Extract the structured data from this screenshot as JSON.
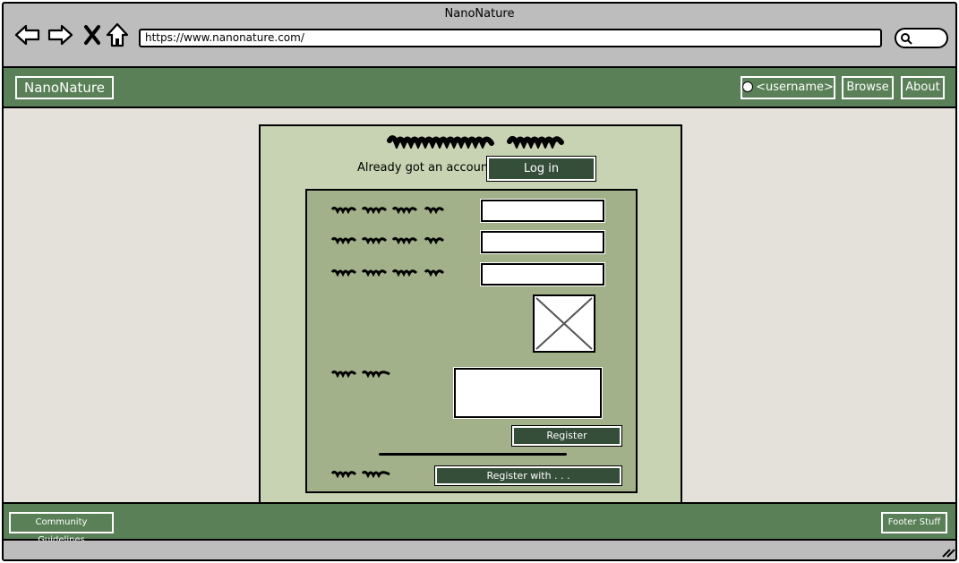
{
  "window": {
    "title": "NanoNature"
  },
  "browser": {
    "url": "https://www.nanonature.com/",
    "icons": [
      "back-arrow-icon",
      "forward-arrow-icon",
      "close-icon",
      "home-icon",
      "search-icon"
    ]
  },
  "header": {
    "brand": "NanoNature",
    "user_label": "<username>",
    "browse_label": "Browse",
    "about_label": "About"
  },
  "register": {
    "already_text": "Already got an account?",
    "login_label": "Log in",
    "register_label": "Register",
    "register_with_label": "Register with . . ."
  },
  "footer": {
    "guidelines_label": "Community Guidelines",
    "footer_stuff_label": "Footer Stuff"
  },
  "colors": {
    "header_green": "#5a8058",
    "panel_green": "#c8d3b3",
    "form_green": "#a2b18a",
    "button_dark": "#354e3a",
    "content_bg": "#e3e1da"
  }
}
